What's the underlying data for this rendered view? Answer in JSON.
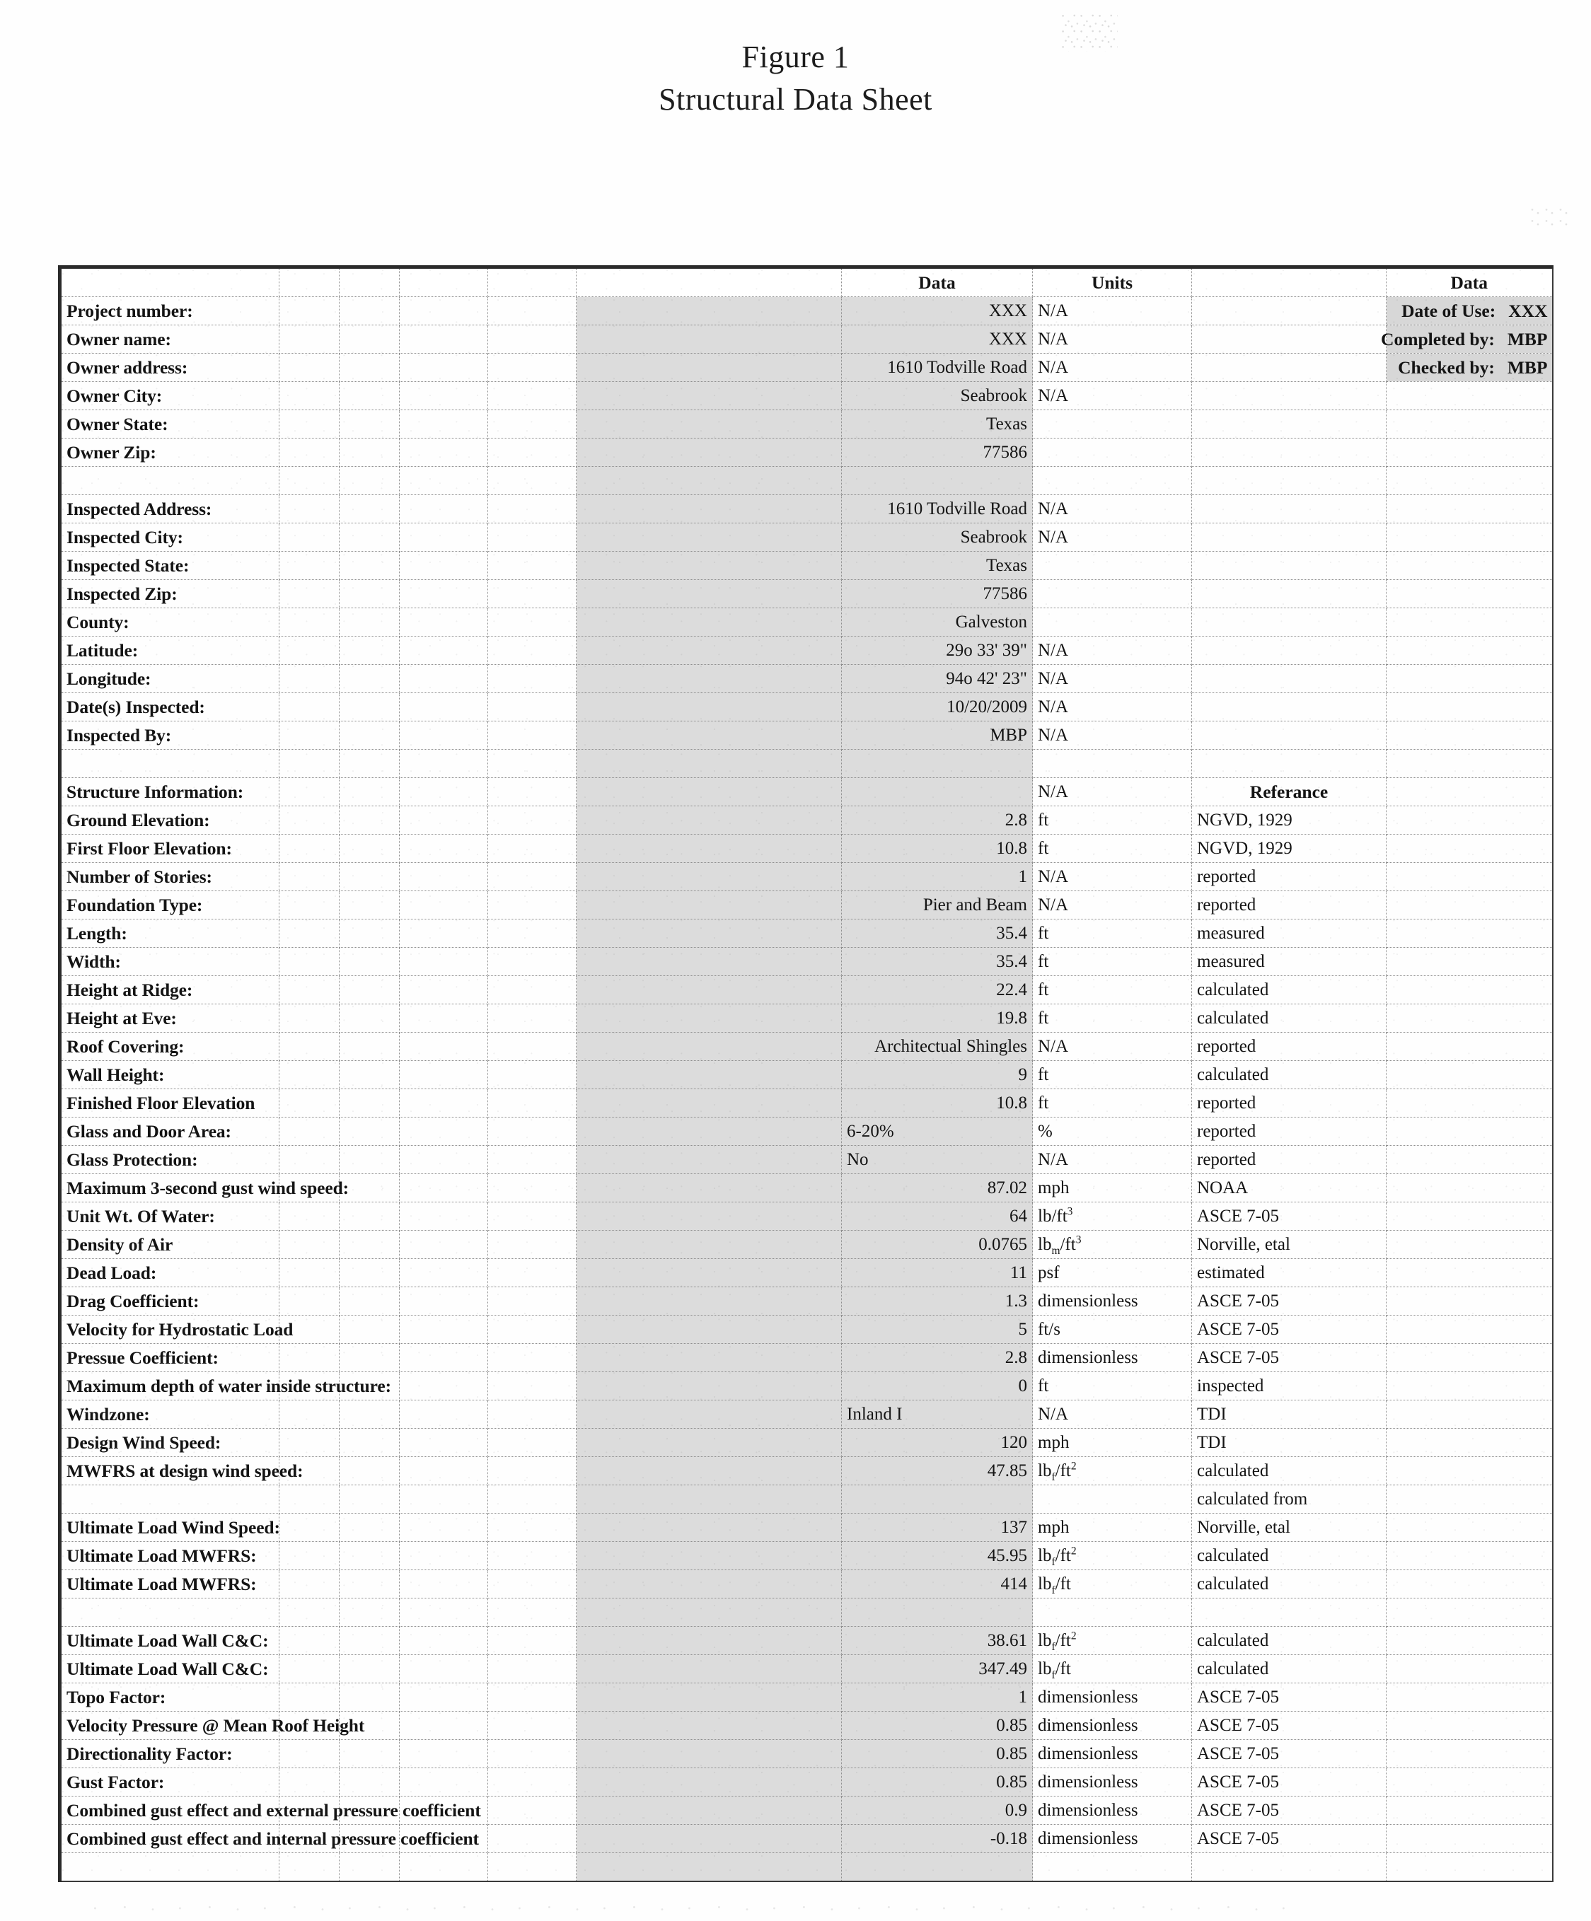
{
  "title": {
    "line1": "Figure 1",
    "line2": "Structural Data Sheet"
  },
  "table": {
    "headers": {
      "data": "Data",
      "units": "Units",
      "data2": "Data"
    },
    "meta": [
      {
        "label": "Date of Use:",
        "value": "XXX"
      },
      {
        "label": "Completed by:",
        "value": "MBP"
      },
      {
        "label": "Checked by:",
        "value": "MBP"
      }
    ],
    "section_header_units": "N/A",
    "section_header_reference": "Referance",
    "rows": [
      {
        "label": "Project number:",
        "value": "XXX",
        "align": "right",
        "units": "N/A",
        "ref": ""
      },
      {
        "label": "Owner name:",
        "value": "XXX",
        "align": "right",
        "units": "N/A",
        "ref": ""
      },
      {
        "label": "Owner address:",
        "value": "1610 Todville Road",
        "align": "right",
        "units": "N/A",
        "ref": ""
      },
      {
        "label": "Owner City:",
        "value": "Seabrook",
        "align": "right",
        "units": "N/A",
        "ref": ""
      },
      {
        "label": "Owner State:",
        "value": "Texas",
        "align": "right",
        "units": "",
        "ref": ""
      },
      {
        "label": "Owner Zip:",
        "value": "77586",
        "align": "right",
        "units": "",
        "ref": ""
      },
      {
        "label": "",
        "value": "",
        "align": "right",
        "units": "",
        "ref": ""
      },
      {
        "label": "Inspected Address:",
        "value": "1610 Todville Road",
        "align": "right",
        "units": "N/A",
        "ref": ""
      },
      {
        "label": "Inspected City:",
        "value": "Seabrook",
        "align": "right",
        "units": "N/A",
        "ref": ""
      },
      {
        "label": "Inspected State:",
        "value": "Texas",
        "align": "right",
        "units": "",
        "ref": ""
      },
      {
        "label": "Inspected Zip:",
        "value": "77586",
        "align": "right",
        "units": "",
        "ref": ""
      },
      {
        "label": "County:",
        "value": "Galveston",
        "align": "right",
        "units": "",
        "ref": ""
      },
      {
        "label": "Latitude:",
        "value": "29o 33' 39\"",
        "align": "right",
        "units": "N/A",
        "ref": ""
      },
      {
        "label": "Longitude:",
        "value": "94o 42' 23\"",
        "align": "right",
        "units": "N/A",
        "ref": ""
      },
      {
        "label": "Date(s) Inspected:",
        "value": "10/20/2009",
        "align": "right",
        "units": "N/A",
        "ref": ""
      },
      {
        "label": "Inspected By:",
        "value": "MBP",
        "align": "right",
        "units": "N/A",
        "ref": ""
      },
      {
        "label": "",
        "value": "",
        "align": "right",
        "units": "",
        "ref": ""
      },
      {
        "label": "Structure Information:",
        "value": "",
        "align": "right",
        "units": "N/A",
        "ref": "Referance",
        "ref_center": true,
        "ref_bold": true
      },
      {
        "label": "Ground Elevation:",
        "value": "2.8",
        "align": "right",
        "units": "ft",
        "ref": "NGVD, 1929"
      },
      {
        "label": "First Floor Elevation:",
        "value": "10.8",
        "align": "right",
        "units": "ft",
        "ref": "NGVD, 1929"
      },
      {
        "label": "Number of Stories:",
        "value": "1",
        "align": "right",
        "units": "N/A",
        "ref": "reported"
      },
      {
        "label": "Foundation Type:",
        "value": "Pier and Beam",
        "align": "right",
        "units": "N/A",
        "ref": "reported"
      },
      {
        "label": "Length:",
        "value": "35.4",
        "align": "right",
        "units": "ft",
        "ref": "measured"
      },
      {
        "label": "Width:",
        "value": "35.4",
        "align": "right",
        "units": "ft",
        "ref": "measured"
      },
      {
        "label": "Height at Ridge:",
        "value": "22.4",
        "align": "right",
        "units": "ft",
        "ref": "calculated"
      },
      {
        "label": "Height at Eve:",
        "value": "19.8",
        "align": "right",
        "units": "ft",
        "ref": "calculated"
      },
      {
        "label": "Roof Covering:",
        "value": "Architectual Shingles",
        "align": "right",
        "units": "N/A",
        "ref": "reported"
      },
      {
        "label": "Wall Height:",
        "value": "9",
        "align": "right",
        "units": "ft",
        "ref": "calculated"
      },
      {
        "label": "Finished Floor Elevation",
        "value": "10.8",
        "align": "right",
        "units": "ft",
        "ref": "reported"
      },
      {
        "label": "Glass and Door Area:",
        "value": "6-20%",
        "align": "left",
        "units": "%",
        "ref": "reported"
      },
      {
        "label": "Glass Protection:",
        "value": "No",
        "align": "left",
        "units": "N/A",
        "ref": "reported"
      },
      {
        "label": "Maximum 3-second gust wind speed:",
        "value": "87.02",
        "align": "right",
        "units": "mph",
        "ref": "NOAA"
      },
      {
        "label": "Unit Wt. Of Water:",
        "value": "64",
        "align": "right",
        "units_html": "lb/ft<sup>3</sup>",
        "ref": "ASCE 7-05"
      },
      {
        "label": "Density of Air",
        "value": "0.0765",
        "align": "right",
        "units_html": "lb<sub>m</sub>/ft<sup>3</sup>",
        "ref": "Norville, etal"
      },
      {
        "label": "Dead Load:",
        "value": "11",
        "align": "right",
        "units": "psf",
        "ref": "estimated"
      },
      {
        "label": "Drag Coefficient:",
        "value": "1.3",
        "align": "right",
        "units": "dimensionless",
        "ref": "ASCE 7-05"
      },
      {
        "label": "Velocity for Hydrostatic Load",
        "value": "5",
        "align": "right",
        "units": "ft/s",
        "ref": "ASCE 7-05"
      },
      {
        "label": "Pressue Coefficient:",
        "value": "2.8",
        "align": "right",
        "units": "dimensionless",
        "ref": "ASCE 7-05"
      },
      {
        "label": "Maximum depth of water inside structure:",
        "value": "0",
        "align": "right",
        "units": "ft",
        "ref": "inspected"
      },
      {
        "label": "Windzone:",
        "value": "Inland I",
        "align": "left",
        "units": "N/A",
        "ref": "TDI"
      },
      {
        "label": "Design Wind Speed:",
        "value": "120",
        "align": "right",
        "units": "mph",
        "ref": "TDI"
      },
      {
        "label": "MWFRS at design wind speed:",
        "value": "47.85",
        "align": "right",
        "units_html": "lb<sub>f</sub>/ft<sup>2</sup>",
        "ref": "calculated"
      },
      {
        "label": "",
        "value": "",
        "align": "right",
        "units": "",
        "ref": "calculated from"
      },
      {
        "label": "Ultimate Load Wind Speed:",
        "value": "137",
        "align": "right",
        "units": "mph",
        "ref": "Norville, etal"
      },
      {
        "label": "Ultimate Load MWFRS:",
        "value": "45.95",
        "align": "right",
        "units_html": "lb<sub>f</sub>/ft<sup>2</sup>",
        "ref": "calculated"
      },
      {
        "label": "Ultimate Load MWFRS:",
        "value": "414",
        "align": "right",
        "units_html": "lb<sub>f</sub>/ft",
        "ref": "calculated"
      },
      {
        "label": "",
        "value": "",
        "align": "right",
        "units": "",
        "ref": ""
      },
      {
        "label": "Ultimate Load Wall C&C:",
        "value": "38.61",
        "align": "right",
        "units_html": "lb<sub>f</sub>/ft<sup>2</sup>",
        "ref": "calculated"
      },
      {
        "label": "Ultimate Load Wall C&C:",
        "value": "347.49",
        "align": "right",
        "units_html": "lb<sub>f</sub>/ft",
        "ref": "calculated"
      },
      {
        "label": "Topo Factor:",
        "value": "1",
        "align": "right",
        "units": "dimensionless",
        "ref": "ASCE 7-05"
      },
      {
        "label": "Velocity Pressure @ Mean Roof Height",
        "value": "0.85",
        "align": "right",
        "units": "dimensionless",
        "ref": "ASCE 7-05"
      },
      {
        "label": "Directionality Factor:",
        "value": "0.85",
        "align": "right",
        "units": "dimensionless",
        "ref": "ASCE 7-05"
      },
      {
        "label": "Gust Factor:",
        "value": "0.85",
        "align": "right",
        "units": "dimensionless",
        "ref": "ASCE 7-05"
      },
      {
        "label": "Combined gust effect and external pressure coefficient",
        "value": "0.9",
        "align": "right",
        "units": "dimensionless",
        "ref": "ASCE 7-05"
      },
      {
        "label": "Combined gust effect and internal pressure coefficient",
        "value": "-0.18",
        "align": "right",
        "units": "dimensionless",
        "ref": "ASCE 7-05"
      },
      {
        "label": "",
        "value": "",
        "align": "right",
        "units": "",
        "ref": ""
      }
    ]
  },
  "colors": {
    "shade": "#dcdcdc",
    "ink": "#141414",
    "grid": "#8e8e8e",
    "frame": "#2a2a2a"
  }
}
